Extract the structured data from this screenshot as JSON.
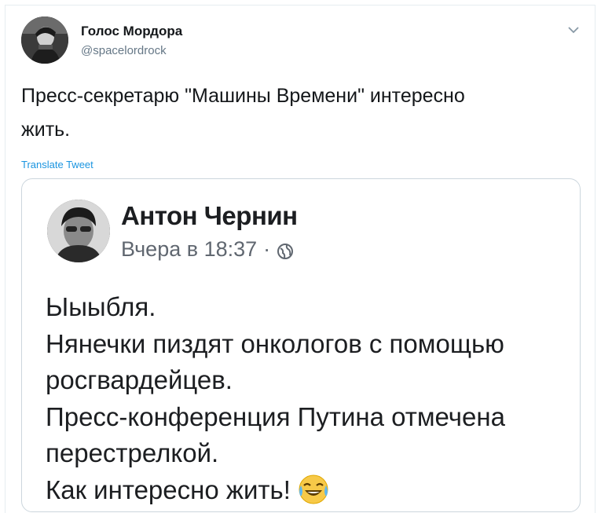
{
  "tweet": {
    "author_name": "Голос Мордора",
    "author_handle": "@spacelordrock",
    "text_lines": [
      "Пресс-секретарю \"Машины Времени\" интересно",
      "жить."
    ],
    "translate_label": "Translate Tweet"
  },
  "card": {
    "author_name": "Антон Чернин",
    "timestamp": "Вчера в 18:37",
    "separator": "·",
    "text_lines": [
      "Ыыыбля.",
      "Нянечки пиздят онкологов с помощью",
      "росгвардейцев.",
      "Пресс-конференция Путина отмечена",
      "перестрелкой.",
      "Как интересно жить!"
    ],
    "emoji": "face-with-tears-of-joy"
  },
  "icons": {
    "caret": "chevron-down-icon",
    "privacy": "globe-icon"
  },
  "colors": {
    "link": "#1b95e0",
    "handle": "#657786",
    "fb_meta": "#606770",
    "border": "#ccd6dd"
  }
}
